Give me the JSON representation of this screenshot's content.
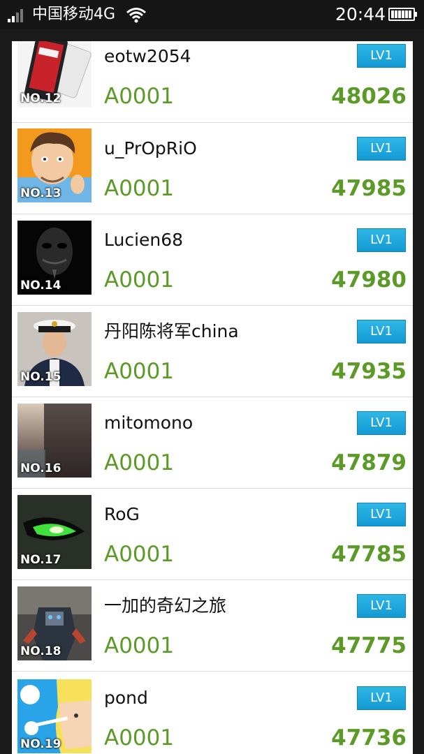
{
  "status_bar": {
    "carrier": "中国移动4G",
    "time": "20:44"
  },
  "leaderboard": {
    "rows": [
      {
        "rank": "NO.12",
        "name": "eotw2054",
        "team": "A0001",
        "score": "48026",
        "level": "LV1",
        "avatar": "phone-photo"
      },
      {
        "rank": "NO.13",
        "name": "u_PrOpRiO",
        "team": "A0001",
        "score": "47985",
        "level": "LV1",
        "avatar": "cartoon-face"
      },
      {
        "rank": "NO.14",
        "name": "Lucien68",
        "team": "A0001",
        "score": "47980",
        "level": "LV1",
        "avatar": "mask-dark"
      },
      {
        "rank": "NO.15",
        "name": "丹阳陈将军china",
        "team": "A0001",
        "score": "47935",
        "level": "LV1",
        "avatar": "officer-photo"
      },
      {
        "rank": "NO.16",
        "name": "mitomono",
        "team": "A0001",
        "score": "47879",
        "level": "LV1",
        "avatar": "dusk-photo"
      },
      {
        "rank": "NO.17",
        "name": "RoG",
        "team": "A0001",
        "score": "47785",
        "level": "LV1",
        "avatar": "rog-eye"
      },
      {
        "rank": "NO.18",
        "name": "一加的奇幻之旅",
        "team": "A0001",
        "score": "47775",
        "level": "LV1",
        "avatar": "robot-photo"
      },
      {
        "rank": "NO.19",
        "name": "pond",
        "team": "A0001",
        "score": "47736",
        "level": "LV1",
        "avatar": "anime-character"
      }
    ]
  },
  "colors": {
    "score_green": "#5c9a27",
    "level_badge_blue": "#1ea8de"
  }
}
